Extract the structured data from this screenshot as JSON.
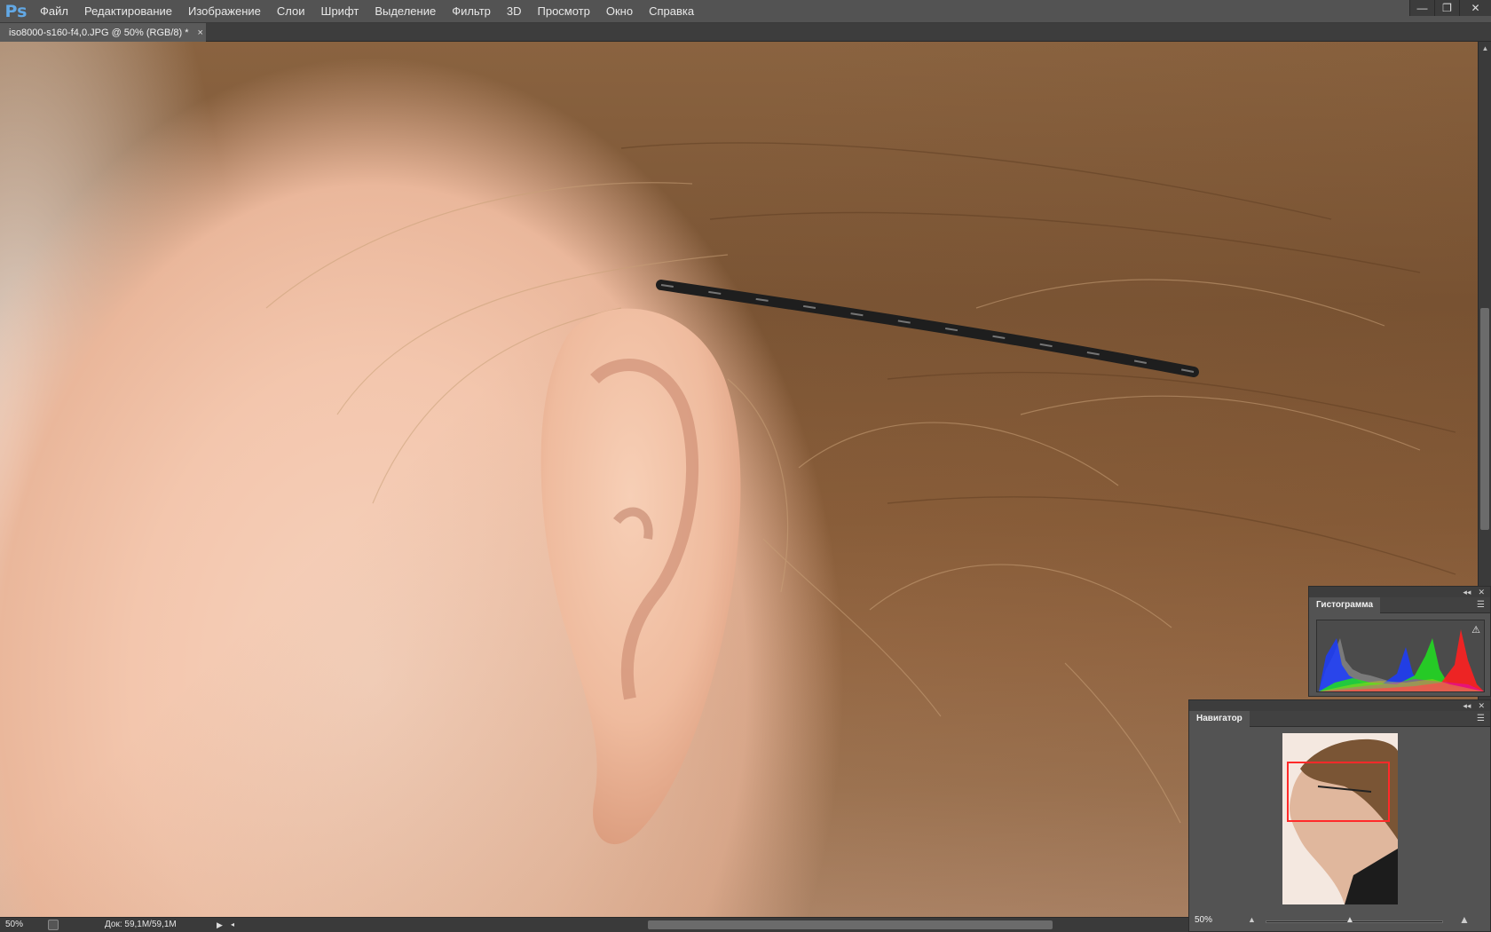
{
  "app": {
    "logo": "Ps"
  },
  "menu": [
    "Файл",
    "Редактирование",
    "Изображение",
    "Слои",
    "Шрифт",
    "Выделение",
    "Фильтр",
    "3D",
    "Просмотр",
    "Окно",
    "Справка"
  ],
  "window_controls": {
    "minimize": "—",
    "restore": "❐",
    "close": "✕"
  },
  "document_tab": {
    "title": "iso8000-s160-f4,0.JPG @ 50% (RGB/8) *",
    "close": "×"
  },
  "status_bar": {
    "zoom": "50%",
    "doc_size": "Док: 59,1M/59,1M",
    "arrow": "▶",
    "scroll_left": "◂"
  },
  "histogram_panel": {
    "title": "Гистограмма",
    "menu_icon": "☰",
    "collapse": "◂◂",
    "close": "✕",
    "warning": "⚠"
  },
  "navigator_panel": {
    "title": "Навигатор",
    "menu_icon": "☰",
    "collapse": "◂◂",
    "close": "✕",
    "zoom": "50%",
    "zoom_out_icon": "▲",
    "zoom_in_icon": "▲"
  },
  "colors": {
    "accent": "#62a8e5",
    "nav_view_box": "#ff2a2a",
    "panel_bg": "#535353",
    "menubar_bg": "#535353"
  }
}
